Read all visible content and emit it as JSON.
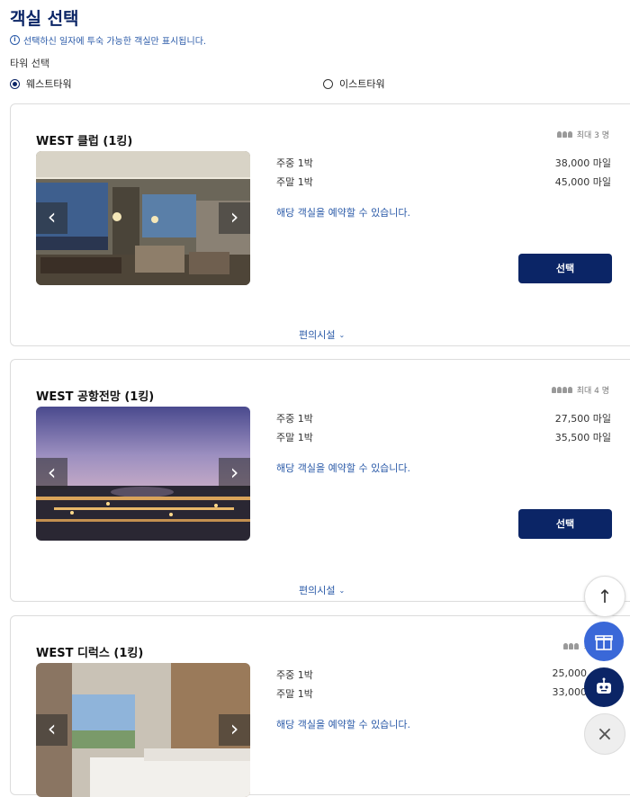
{
  "header": {
    "title": "객실 선택",
    "notice": "선택하신 일자에 투숙 가능한 객실만 표시됩니다.",
    "tower_label": "타워 선택"
  },
  "towers": [
    {
      "label": "웨스트타워",
      "selected": true
    },
    {
      "label": "이스트타워",
      "selected": false
    }
  ],
  "rooms": [
    {
      "name": "WEST 클럽 (1킹)",
      "capacity": "최대 3 명",
      "weekday_label": "주중 1박",
      "weekday_price": "38,000 마일",
      "weekend_label": "주말 1박",
      "weekend_price": "45,000 마일",
      "availability": "해당 객실을 예약할 수 있습니다.",
      "select_label": "선택",
      "amenities_label": "편의시설"
    },
    {
      "name": "WEST 공항전망 (1킹)",
      "capacity": "최대 4 명",
      "weekday_label": "주중 1박",
      "weekday_price": "27,500 마일",
      "weekend_label": "주말 1박",
      "weekend_price": "35,500 마일",
      "availability": "해당 객실을 예약할 수 있습니다.",
      "select_label": "선택",
      "amenities_label": "편의시설"
    },
    {
      "name": "WEST 디럭스 (1킹)",
      "capacity": "최대",
      "weekday_label": "주중 1박",
      "weekday_price": "25,000",
      "weekend_label": "주말 1박",
      "weekend_price": "33,000",
      "availability": "해당 객실을 예약할 수 있습니다.",
      "select_label": "선택",
      "amenities_label": "편의시설"
    }
  ],
  "colors": {
    "primary": "#0b2566",
    "link": "#2a5aa8",
    "gift_fab": "#3a68d8"
  },
  "icons": {
    "prev": "‹",
    "next": "›",
    "scroll_top": "↑",
    "close": "×"
  }
}
